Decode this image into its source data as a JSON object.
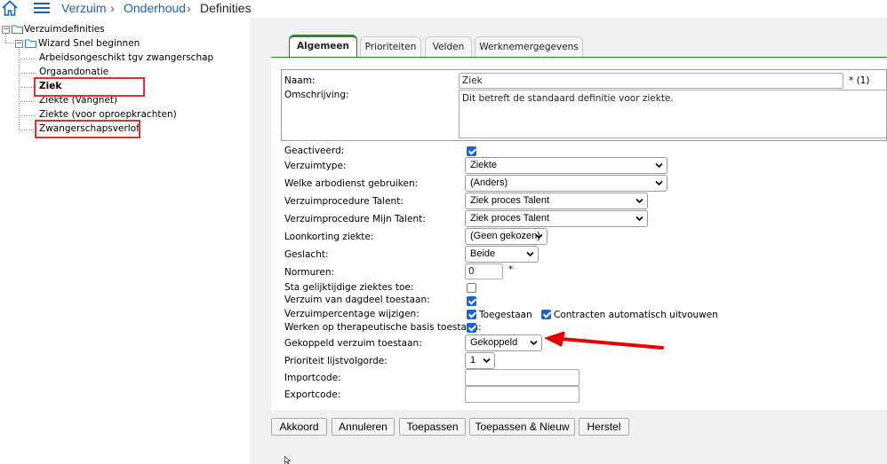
{
  "breadcrumb": {
    "items": [
      "Verzuim",
      "Onderhoud",
      "Definities"
    ],
    "separator": "›"
  },
  "tree": {
    "root": "Verzuimdefinities",
    "group": "Wizard Snel beginnen",
    "items": [
      "Arbeidsongeschikt tgv zwangerschap",
      "Orgaandonatie",
      "Ziek",
      "Ziekte (Vangnet)",
      "Ziekte (voor oproepkrachten)",
      "Zwangerschapsverlof"
    ]
  },
  "tabs": [
    "Algemeen",
    "Prioriteiten",
    "Velden",
    "Werknemergegevens"
  ],
  "form": {
    "naam_label": "Naam:",
    "naam_value": "Ziek",
    "naam_suffix": "* (1)",
    "omschrijving_label": "Omschrijving:",
    "omschrijving_value": "Dit betreft de standaard definitie voor ziekte.",
    "geactiveerd_label": "Geactiveerd:",
    "verzuimtype_label": "Verzuimtype:",
    "verzuimtype_value": "Ziekte",
    "arbodienst_label": "Welke arbodienst gebruiken:",
    "arbodienst_value": "(Anders)",
    "procedure_talent_label": "Verzuimprocedure Talent:",
    "procedure_talent_value": "Ziek proces Talent",
    "procedure_mijn_label": "Verzuimprocedure Mijn Talent:",
    "procedure_mijn_value": "Ziek proces Talent",
    "loonkorting_label": "Loonkorting ziekte:",
    "loonkorting_value": "(Geen gekozen)",
    "geslacht_label": "Geslacht:",
    "geslacht_value": "Beide",
    "normuren_label": "Normuren:",
    "normuren_value": "0",
    "normuren_suffix": "*",
    "gelijktijdig_label": "Sta gelijktijdige ziektes toe:",
    "dagdeel_label": "Verzuim van dagdeel toestaan:",
    "percentage_label": "Verzuimpercentage wijzigen:",
    "toegestaan_label": "Toegestaan",
    "contracten_label": "Contracten automatisch uitvouwen",
    "therapeutisch_label": "Werken op therapeutische basis toestaan:",
    "gekoppeld_label": "Gekoppeld verzuim toestaan:",
    "gekoppeld_value": "Gekoppeld",
    "prioriteit_label": "Prioriteit lijstvolgorde:",
    "prioriteit_value": "1",
    "importcode_label": "Importcode:",
    "exportcode_label": "Exportcode:"
  },
  "buttons": [
    "Akkoord",
    "Annuleren",
    "Toepassen",
    "Toepassen & Nieuw",
    "Herstel"
  ],
  "colors": {
    "link": "#1a62b0",
    "tab_accent": "#2a8a2a",
    "highlight": "#e03030",
    "checkbox": "#1566d6"
  }
}
